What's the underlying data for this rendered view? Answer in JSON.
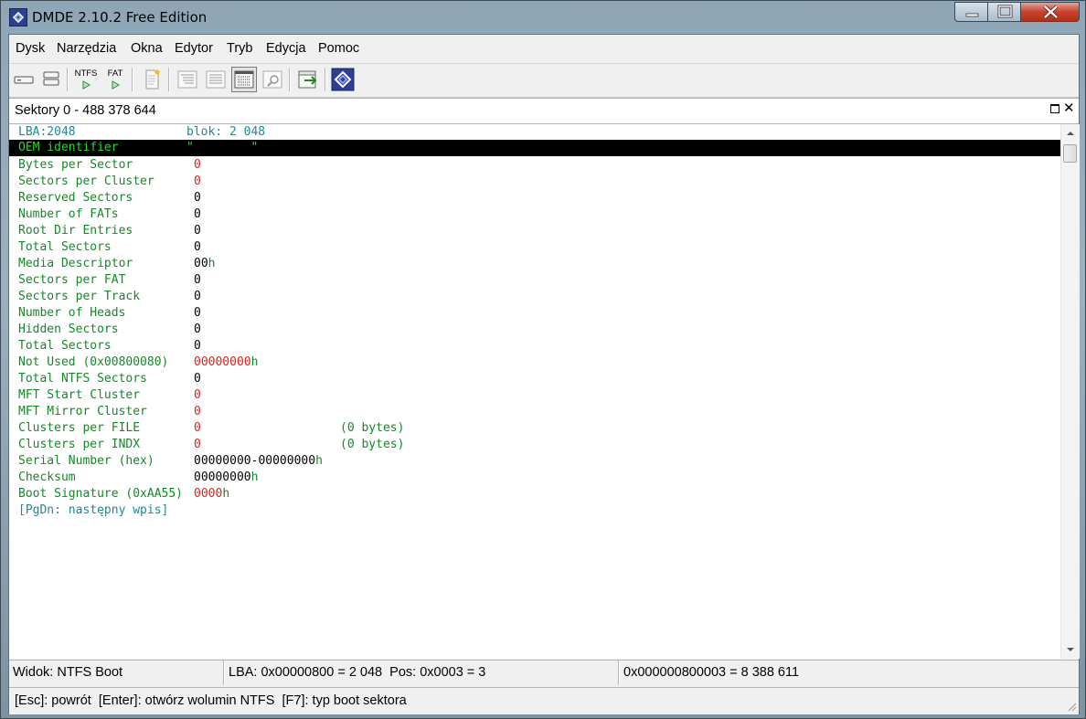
{
  "window": {
    "title": "DMDE 2.10.2 Free Edition"
  },
  "menu": [
    {
      "label": "Dysk"
    },
    {
      "label": "Narzędzia"
    },
    {
      "label": "Okna"
    },
    {
      "label": "Edytor"
    },
    {
      "label": "Tryb"
    },
    {
      "label": "Edycja"
    },
    {
      "label": "Pomoc"
    }
  ],
  "toolbar": {
    "ntfs_label": "NTFS",
    "fat_label": "FAT"
  },
  "panel": {
    "title": "Sektory 0 - 488 378 644"
  },
  "editor": {
    "lba": "LBA:2048",
    "blok": "blok: 2 048",
    "oem_label": "OEM identifier",
    "oem_value": "\"        \"",
    "fields": [
      {
        "label": "Bytes per Sector",
        "value": "0",
        "suffix": "",
        "value_color": "red",
        "extra": ""
      },
      {
        "label": "Sectors per Cluster",
        "value": "0",
        "suffix": "",
        "value_color": "red",
        "extra": ""
      },
      {
        "label": "Reserved Sectors",
        "value": "0",
        "suffix": "",
        "value_color": "black",
        "extra": ""
      },
      {
        "label": "Number of FATs",
        "value": "0",
        "suffix": "",
        "value_color": "black",
        "extra": ""
      },
      {
        "label": "Root Dir Entries",
        "value": "0",
        "suffix": "",
        "value_color": "black",
        "extra": ""
      },
      {
        "label": "Total Sectors",
        "value": "0",
        "suffix": "",
        "value_color": "black",
        "extra": ""
      },
      {
        "label": "Media Descriptor",
        "value": "00",
        "suffix": "h",
        "value_color": "black",
        "extra": ""
      },
      {
        "label": "Sectors per FAT",
        "value": "0",
        "suffix": "",
        "value_color": "black",
        "extra": ""
      },
      {
        "label": "Sectors per Track",
        "value": "0",
        "suffix": "",
        "value_color": "black",
        "extra": ""
      },
      {
        "label": "Number of Heads",
        "value": "0",
        "suffix": "",
        "value_color": "black",
        "extra": ""
      },
      {
        "label": "Hidden Sectors",
        "value": "0",
        "suffix": "",
        "value_color": "black",
        "extra": ""
      },
      {
        "label": "Total Sectors",
        "value": "0",
        "suffix": "",
        "value_color": "black",
        "extra": ""
      },
      {
        "label": "Not Used (0x00800080)",
        "value": "00000000",
        "suffix": "h",
        "value_color": "red",
        "extra": ""
      },
      {
        "label": "Total NTFS Sectors",
        "value": "0",
        "suffix": "",
        "value_color": "black",
        "extra": ""
      },
      {
        "label": "MFT Start Cluster",
        "value": "0",
        "suffix": "",
        "value_color": "red",
        "extra": ""
      },
      {
        "label": "MFT Mirror Cluster",
        "value": "0",
        "suffix": "",
        "value_color": "red",
        "extra": ""
      },
      {
        "label": "Clusters per FILE",
        "value": "0",
        "suffix": "",
        "value_color": "red",
        "extra": "(0 bytes)"
      },
      {
        "label": "Clusters per INDX",
        "value": "0",
        "suffix": "",
        "value_color": "red",
        "extra": "(0 bytes)"
      },
      {
        "label": "Serial Number (hex)",
        "value": "00000000-00000000",
        "suffix": "h",
        "value_color": "black",
        "extra": ""
      },
      {
        "label": "Checksum",
        "value": "00000000",
        "suffix": "h",
        "value_color": "black",
        "extra": ""
      },
      {
        "label": "Boot Signature (0xAA55)",
        "value": "0000",
        "suffix": "h",
        "value_color": "red",
        "extra": ""
      }
    ],
    "next_hint": "[PgDn: następny wpis]"
  },
  "status": {
    "view": "Widok: NTFS Boot",
    "position": "LBA: 0x00000800 = 2 048  Pos: 0x0003 = 3",
    "offset": "0x000000800003 = 8 388 611"
  },
  "hints": "[Esc]: powrót  [Enter]: otwórz wolumin NTFS  [F7]: typ boot sektora",
  "colors": {
    "label": "#128a26",
    "cyan": "#1a8a9a",
    "red": "#e0201a",
    "highlight_bg": "#000000",
    "highlight_text": "#2bd82b"
  }
}
